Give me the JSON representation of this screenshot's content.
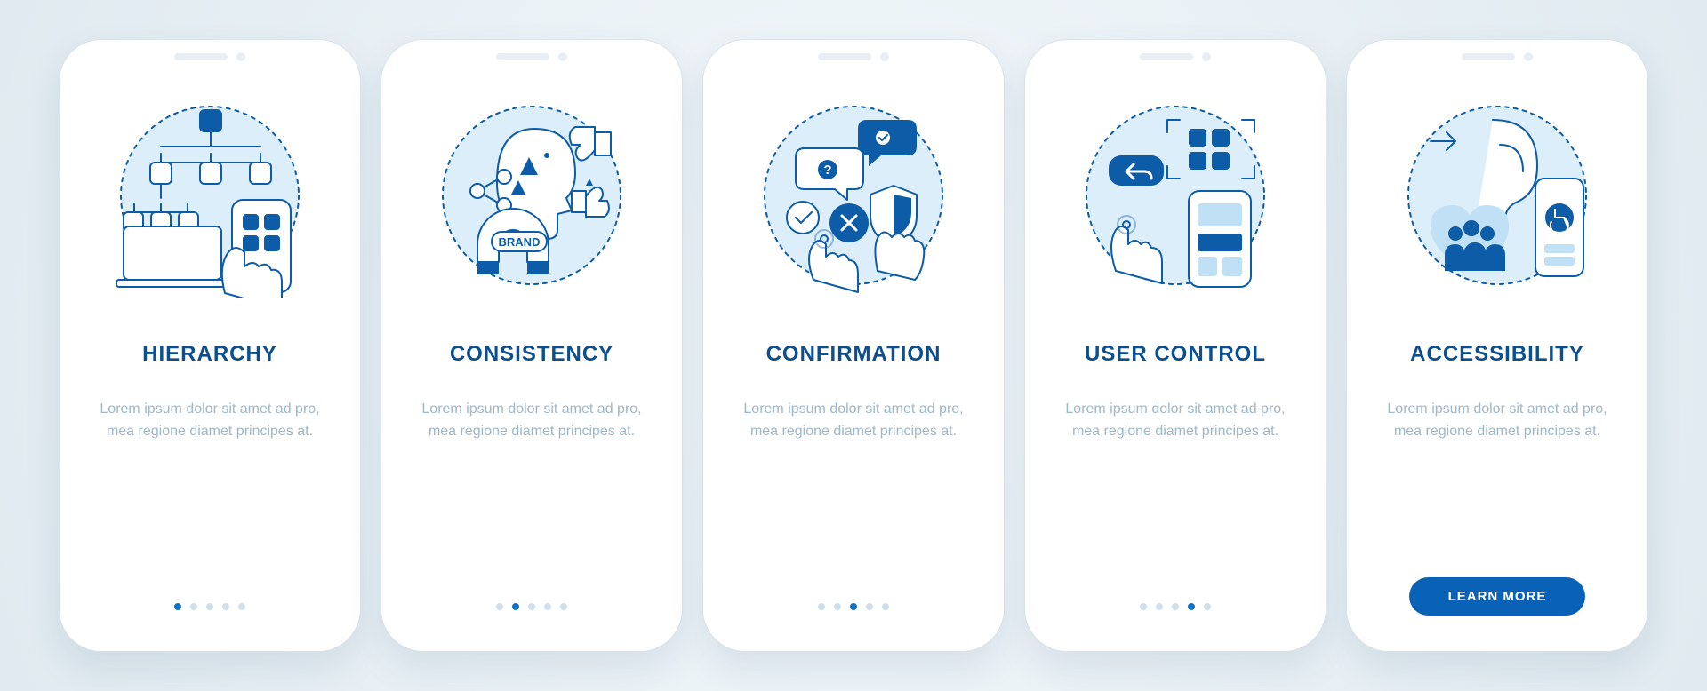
{
  "screens": [
    {
      "icon": "hierarchy-icon",
      "title": "HIERARCHY",
      "desc": "Lorem ipsum dolor sit amet ad pro, mea regione diamet principes at.",
      "active_dot": 0
    },
    {
      "icon": "consistency-icon",
      "title": "CONSISTENCY",
      "desc": "Lorem ipsum dolor sit amet ad pro, mea regione diamet principes at.",
      "active_dot": 1
    },
    {
      "icon": "confirmation-icon",
      "title": "CONFIRMATION",
      "desc": "Lorem ipsum dolor sit amet ad pro, mea regione diamet principes at.",
      "active_dot": 2
    },
    {
      "icon": "user-control-icon",
      "title": "USER CONTROL",
      "desc": "Lorem ipsum dolor sit amet ad pro, mea regione diamet principes at.",
      "active_dot": 3
    },
    {
      "icon": "accessibility-icon",
      "title": "ACCESSIBILITY",
      "desc": "Lorem ipsum dolor sit amet ad pro, mea regione diamet principes at.",
      "active_dot": 4,
      "cta": "LEARN MORE"
    }
  ],
  "total_dots": 5,
  "colors": {
    "brand": "#0c5ca8",
    "light": "#bfe0f5",
    "text_muted": "#9eb7c9"
  }
}
